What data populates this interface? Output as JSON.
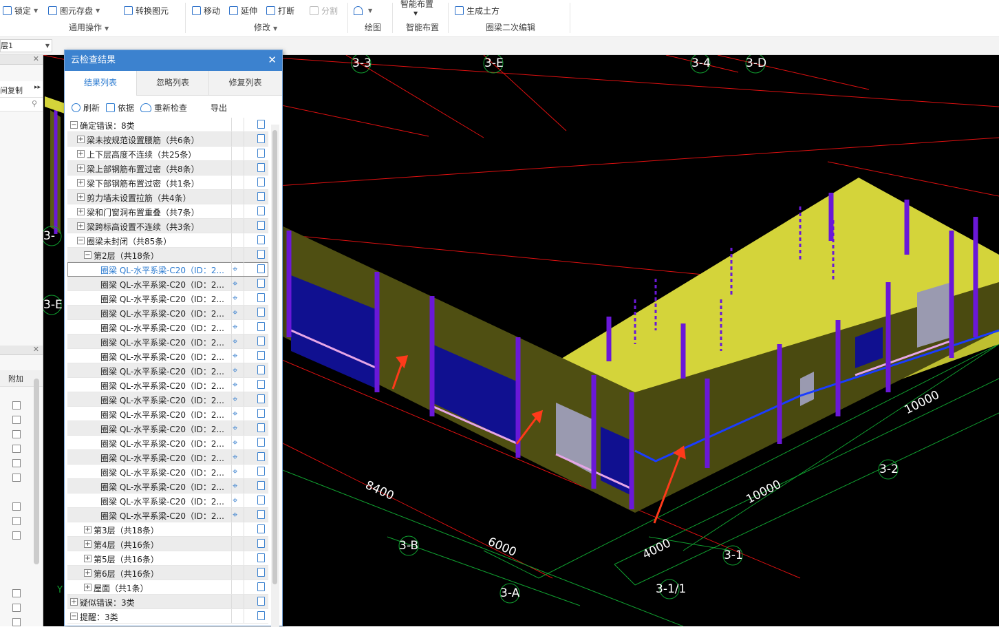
{
  "ribbon": {
    "lock": "锁定",
    "save_elements": "图元存盘",
    "convert_elements": "转换图元",
    "move": "移动",
    "extend": "延伸",
    "break": "打断",
    "split": "分割",
    "smart_layout": "智能布置",
    "generate_earth": "生成土方",
    "groups": {
      "general": "通用操作",
      "modify": "修改",
      "draw": "绘图",
      "smart": "智能布置",
      "ringbeam_edit": "圈梁二次编辑"
    }
  },
  "floor_combo": {
    "value": "层1"
  },
  "left_panel": {
    "copy_label": "间复制",
    "attach_label": "附加"
  },
  "dialog": {
    "title": "云检查结果",
    "tabs": [
      "结果列表",
      "忽略列表",
      "修复列表"
    ],
    "toolbar": {
      "refresh": "刷新",
      "basis": "依据",
      "recheck": "重新检查",
      "export": "导出"
    },
    "tree": [
      {
        "label": "确定错误：8类",
        "level": 0,
        "toggle": "-"
      },
      {
        "label": "梁未按规范设置腰筋（共6条）",
        "level": 1,
        "toggle": "+"
      },
      {
        "label": "上下层高度不连续（共25条）",
        "level": 1,
        "toggle": "+"
      },
      {
        "label": "梁上部钢筋布置过密（共8条）",
        "level": 1,
        "toggle": "+"
      },
      {
        "label": "梁下部钢筋布置过密（共1条）",
        "level": 1,
        "toggle": "+"
      },
      {
        "label": "剪力墙未设置拉筋（共4条）",
        "level": 1,
        "toggle": "+"
      },
      {
        "label": "梁和门窗洞布置重叠（共7条）",
        "level": 1,
        "toggle": "+"
      },
      {
        "label": "梁跨标高设置不连续（共3条）",
        "level": 1,
        "toggle": "+"
      },
      {
        "label": "圈梁未封闭（共85条）",
        "level": 1,
        "toggle": "-"
      },
      {
        "label": "第2层（共18条）",
        "level": 2,
        "toggle": "-"
      },
      {
        "label": "圈梁 QL-水平系梁-C20（ID：2...",
        "level": 3,
        "selected": true
      },
      {
        "label": "圈梁 QL-水平系梁-C20（ID：2...",
        "level": 3
      },
      {
        "label": "圈梁 QL-水平系梁-C20（ID：2...",
        "level": 3
      },
      {
        "label": "圈梁 QL-水平系梁-C20（ID：2...",
        "level": 3
      },
      {
        "label": "圈梁 QL-水平系梁-C20（ID：2...",
        "level": 3
      },
      {
        "label": "圈梁 QL-水平系梁-C20（ID：2...",
        "level": 3
      },
      {
        "label": "圈梁 QL-水平系梁-C20（ID：2...",
        "level": 3
      },
      {
        "label": "圈梁 QL-水平系梁-C20（ID：2...",
        "level": 3
      },
      {
        "label": "圈梁 QL-水平系梁-C20（ID：2...",
        "level": 3
      },
      {
        "label": "圈梁 QL-水平系梁-C20（ID：2...",
        "level": 3
      },
      {
        "label": "圈梁 QL-水平系梁-C20（ID：2...",
        "level": 3
      },
      {
        "label": "圈梁 QL-水平系梁-C20（ID：2...",
        "level": 3
      },
      {
        "label": "圈梁 QL-水平系梁-C20（ID：2...",
        "level": 3
      },
      {
        "label": "圈梁 QL-水平系梁-C20（ID：2...",
        "level": 3
      },
      {
        "label": "圈梁 QL-水平系梁-C20（ID：2...",
        "level": 3
      },
      {
        "label": "圈梁 QL-水平系梁-C20（ID：2...",
        "level": 3
      },
      {
        "label": "圈梁 QL-水平系梁-C20（ID：2...",
        "level": 3
      },
      {
        "label": "圈梁 QL-水平系梁-C20（ID：2...",
        "level": 3
      },
      {
        "label": "第3层（共18条）",
        "level": 2,
        "toggle": "+"
      },
      {
        "label": "第4层（共16条）",
        "level": 2,
        "toggle": "+"
      },
      {
        "label": "第5层（共16条）",
        "level": 2,
        "toggle": "+"
      },
      {
        "label": "第6层（共16条）",
        "level": 2,
        "toggle": "+"
      },
      {
        "label": "屋面（共1条）",
        "level": 2,
        "toggle": "+"
      },
      {
        "label": "疑似错误：3类",
        "level": 0,
        "toggle": "+"
      },
      {
        "label": "提醒：3类",
        "level": 0,
        "toggle": "-"
      }
    ]
  },
  "viewport": {
    "axis_labels": [
      "3-3",
      "3-E",
      "3-4",
      "3-D",
      "3-2",
      "3-1",
      "3-1/1",
      "3-A",
      "3-B",
      "3-E",
      "3-"
    ],
    "dimensions": [
      "10000",
      "10000",
      "8400",
      "6000",
      "4000"
    ],
    "colors": {
      "grid_red": "#e01010",
      "grid_green": "#10a030",
      "wall": "#4f4f12",
      "slab": "#d8d83a",
      "column": "#6a18d8",
      "window": "#1010a0",
      "arrow": "#ff3a1a"
    }
  }
}
